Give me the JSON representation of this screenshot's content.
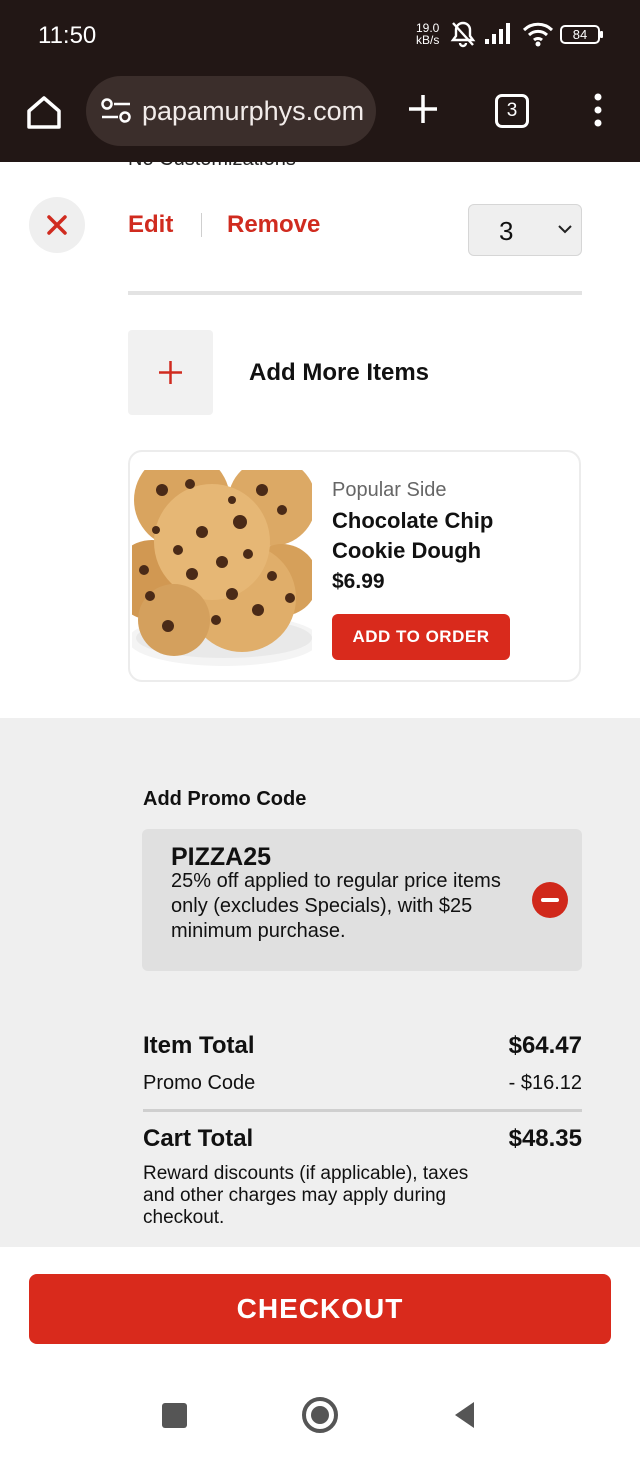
{
  "status_bar": {
    "time": "11:50",
    "net_speed_value": "19.0",
    "net_speed_unit": "kB/s",
    "battery": "84",
    "icons": [
      "bell-off-icon",
      "signal-icon",
      "wifi-icon",
      "battery-icon"
    ]
  },
  "browser": {
    "url": "papamurphys.com",
    "tab_count": "3",
    "icons": [
      "home-icon",
      "site-settings-icon",
      "plus-icon",
      "tabs-icon",
      "more-vert-icon"
    ]
  },
  "cart_item": {
    "partial_text": "No Customizations",
    "edit_label": "Edit",
    "remove_label": "Remove",
    "quantity": "3"
  },
  "add_more": {
    "label": "Add More Items"
  },
  "upsell": {
    "category": "Popular Side",
    "name": "Chocolate Chip Cookie Dough",
    "price": "$6.99",
    "button_label": "ADD TO ORDER"
  },
  "promo": {
    "heading": "Add Promo Code",
    "code": "PIZZA25",
    "description": "25% off applied to regular price items only (excludes Specials), with $25 minimum purchase."
  },
  "totals": {
    "item_total_label": "Item Total",
    "item_total_value": "$64.47",
    "promo_label": "Promo Code",
    "promo_value": "- $16.12",
    "cart_total_label": "Cart Total",
    "cart_total_value": "$48.35",
    "disclaimer": "Reward discounts (if applicable), taxes and other charges may apply during checkout."
  },
  "checkout": {
    "label": "CHECKOUT"
  },
  "colors": {
    "brand_red": "#d92a1c",
    "browser_bar": "#221715",
    "grey_panel": "#efefef"
  }
}
